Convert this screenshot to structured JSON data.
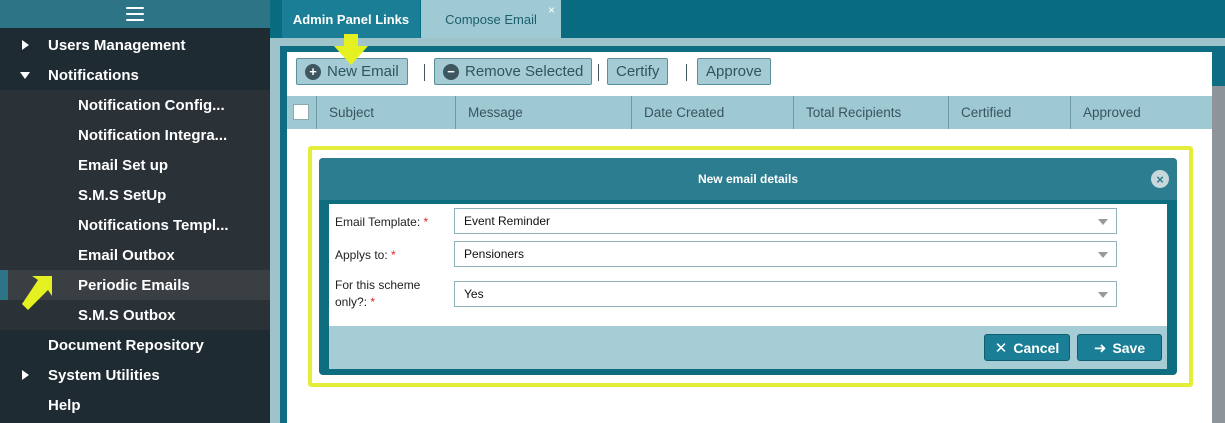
{
  "sidebar": {
    "items": [
      {
        "label": "Users Management",
        "level": "top",
        "caret": "right"
      },
      {
        "label": "Notifications",
        "level": "top",
        "caret": "down"
      },
      {
        "label": "Notification Config...",
        "level": "sub"
      },
      {
        "label": "Notification Integra...",
        "level": "sub"
      },
      {
        "label": "Email Set up",
        "level": "sub"
      },
      {
        "label": "S.M.S SetUp",
        "level": "sub"
      },
      {
        "label": "Notifications Templ...",
        "level": "sub"
      },
      {
        "label": "Email Outbox",
        "level": "sub"
      },
      {
        "label": "Periodic Emails",
        "level": "sub",
        "active": true
      },
      {
        "label": "S.M.S Outbox",
        "level": "sub"
      },
      {
        "label": "Document Repository",
        "level": "top"
      },
      {
        "label": "System Utilities",
        "level": "top",
        "caret": "right"
      },
      {
        "label": "Help",
        "level": "top"
      }
    ]
  },
  "tabs": [
    {
      "label": "Admin Panel Links"
    },
    {
      "label": "Compose Email",
      "close": "×"
    }
  ],
  "toolbar": {
    "new_label": "New Email",
    "remove_label": "Remove Selected",
    "certify_label": "Certify",
    "approve_label": "Approve"
  },
  "table": {
    "columns": [
      "Subject",
      "Message",
      "Date Created",
      "Total Recipients",
      "Certified",
      "Approved"
    ]
  },
  "dialog": {
    "title": "New email details",
    "fields": [
      {
        "label": "Email Template:",
        "value": "Event Reminder"
      },
      {
        "label": "Applys to:",
        "value": "Pensioners"
      },
      {
        "label": "For this scheme only?:",
        "value": "Yes"
      }
    ],
    "required_mark": "*",
    "cancel_label": "Cancel",
    "save_label": "Save"
  },
  "colors": {
    "accent": "#1a7f96",
    "highlight": "#e4ee3a",
    "sidebar_bg": "#1f2b33",
    "topbar": "#086b80"
  }
}
